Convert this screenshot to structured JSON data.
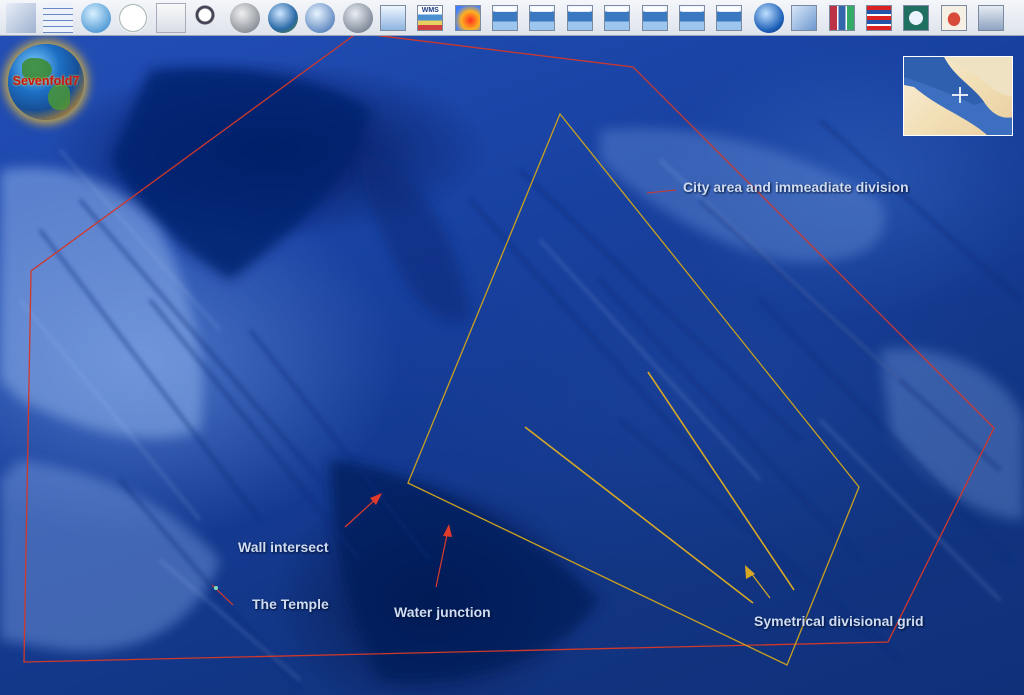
{
  "app": {
    "logo_text": "Sevenfold7"
  },
  "toolbar": {
    "buttons": [
      {
        "icon": "layers-icon"
      },
      {
        "icon": "grid-icon"
      },
      {
        "icon": "globe-latlon-icon"
      },
      {
        "icon": "clock-icon"
      },
      {
        "icon": "compass-rose-icon"
      },
      {
        "icon": "magnifier-icon"
      },
      {
        "icon": "earth-grey-icon"
      },
      {
        "icon": "earth-icon"
      },
      {
        "icon": "earth-blue-icon"
      },
      {
        "icon": "earth-add-icon"
      },
      {
        "icon": "layer-world-icon"
      },
      {
        "icon": "layer-wms-icon",
        "text": "WMS"
      },
      {
        "icon": "layer-heatmap-icon"
      },
      {
        "icon": "layer-nasa-icon"
      },
      {
        "icon": "layer-nasa-icon"
      },
      {
        "icon": "layer-nasa-icon"
      },
      {
        "icon": "layer-nasa-icon"
      },
      {
        "icon": "layer-nasa-icon"
      },
      {
        "icon": "layer-nasa-icon"
      },
      {
        "icon": "layer-nasa-icon"
      },
      {
        "icon": "globe-blue-icon"
      },
      {
        "icon": "layer-europe-icon"
      },
      {
        "icon": "layer-thumbnails-icon"
      },
      {
        "icon": "layer-flags-icon"
      },
      {
        "icon": "layer-landmarks-icon"
      },
      {
        "icon": "layer-usa-icon"
      },
      {
        "icon": "layer-crosshair-icon"
      }
    ]
  },
  "annotations": [
    {
      "label": "City area and immeadiate division"
    },
    {
      "label": "Wall intersect"
    },
    {
      "label": "The Temple"
    },
    {
      "label": "Water junction"
    },
    {
      "label": "Symetrical divisional grid"
    }
  ],
  "colors": {
    "outer_polygon": "#d0382a",
    "inner_polygon": "#c8a020",
    "grid_lines": "#d8a825",
    "arrow": "#e03a2a"
  }
}
